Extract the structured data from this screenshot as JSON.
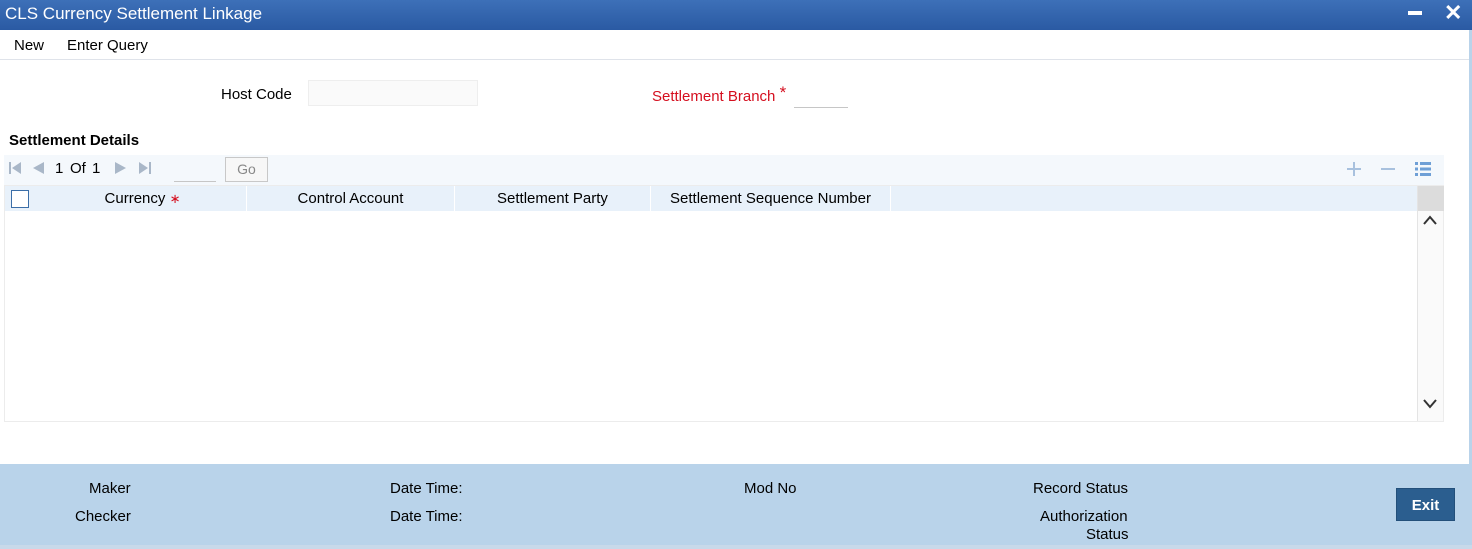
{
  "window": {
    "title": "CLS Currency Settlement Linkage",
    "minimize_icon": "minimize-icon",
    "close_icon": "close-icon",
    "close_glyph": "✕"
  },
  "menu": {
    "new_label": "New",
    "enter_query_label": "Enter Query"
  },
  "form": {
    "host_code_label": "Host Code",
    "host_code_value": "",
    "settlement_branch_label": "Settlement Branch",
    "required_mark": "*",
    "settlement_branch_value": ""
  },
  "settlement_details": {
    "title": "Settlement Details",
    "pager": {
      "current": "1",
      "of_label": "Of",
      "total": "1",
      "go_label": "Go",
      "page_input": ""
    },
    "columns": [
      {
        "label": "Currency",
        "required": "∗"
      },
      {
        "label": "Control Account"
      },
      {
        "label": "Settlement Party"
      },
      {
        "label": "Settlement Sequence Number"
      }
    ],
    "rows": []
  },
  "footer": {
    "maker_label": "Maker",
    "checker_label": "Checker",
    "date_time_label_1": "Date Time:",
    "date_time_label_2": "Date Time:",
    "mod_no_label": "Mod No",
    "record_status_label": "Record Status",
    "authorization_label": "Authorization",
    "status_label": "Status",
    "exit_label": "Exit"
  },
  "colors": {
    "title_bar": "#2d5ea6",
    "footer": "#b9d3ea",
    "required": "#d50f1f",
    "exit_button": "#2b5e8f"
  }
}
